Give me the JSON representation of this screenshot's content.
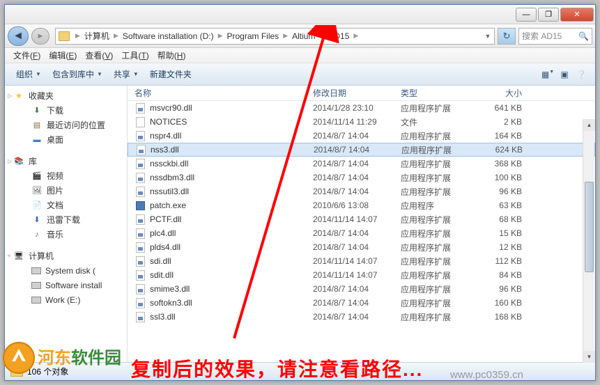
{
  "window": {
    "min": "—",
    "max": "❐",
    "close": "✕"
  },
  "nav": {
    "back": "◄",
    "fwd": "►",
    "refresh": "↻",
    "dropdown": "▼"
  },
  "breadcrumbs": [
    "计算机",
    "Software installation (D:)",
    "Program Files",
    "Altium",
    "AD15"
  ],
  "search": {
    "placeholder": "搜索 AD15",
    "icon": "🔍"
  },
  "menubar": [
    {
      "label": "文件",
      "key": "F"
    },
    {
      "label": "编辑",
      "key": "E"
    },
    {
      "label": "查看",
      "key": "V"
    },
    {
      "label": "工具",
      "key": "T"
    },
    {
      "label": "帮助",
      "key": "H"
    }
  ],
  "toolbar": {
    "organize": "组织",
    "include": "包含到库中",
    "share": "共享",
    "newfolder": "新建文件夹"
  },
  "columns": {
    "name": "名称",
    "date": "修改日期",
    "type": "类型",
    "size": "大小"
  },
  "sidebar": {
    "favorites": "收藏夹",
    "downloads": "下载",
    "recent": "最近访问的位置",
    "desktop": "桌面",
    "libraries": "库",
    "videos": "视频",
    "pictures": "图片",
    "documents": "文档",
    "xunlei": "迅雷下载",
    "music": "音乐",
    "computer": "计算机",
    "sysdisk": "System disk (",
    "softinst": "Software install",
    "work": "Work (E:)"
  },
  "files": [
    {
      "icon": "dll",
      "name": "msvcr90.dll",
      "date": "2014/1/28 23:10",
      "type": "应用程序扩展",
      "size": "641 KB"
    },
    {
      "icon": "txt",
      "name": "NOTICES",
      "date": "2014/11/14 11:29",
      "type": "文件",
      "size": "2 KB"
    },
    {
      "icon": "dll",
      "name": "nspr4.dll",
      "date": "2014/8/7 14:04",
      "type": "应用程序扩展",
      "size": "164 KB"
    },
    {
      "icon": "dll",
      "name": "nss3.dll",
      "date": "2014/8/7 14:04",
      "type": "应用程序扩展",
      "size": "624 KB",
      "selected": true
    },
    {
      "icon": "dll",
      "name": "nssckbi.dll",
      "date": "2014/8/7 14:04",
      "type": "应用程序扩展",
      "size": "368 KB"
    },
    {
      "icon": "dll",
      "name": "nssdbm3.dll",
      "date": "2014/8/7 14:04",
      "type": "应用程序扩展",
      "size": "100 KB"
    },
    {
      "icon": "dll",
      "name": "nssutil3.dll",
      "date": "2014/8/7 14:04",
      "type": "应用程序扩展",
      "size": "96 KB"
    },
    {
      "icon": "exe",
      "name": "patch.exe",
      "date": "2010/6/6 13:08",
      "type": "应用程序",
      "size": "63 KB"
    },
    {
      "icon": "dll",
      "name": "PCTF.dll",
      "date": "2014/11/14 14:07",
      "type": "应用程序扩展",
      "size": "68 KB"
    },
    {
      "icon": "dll",
      "name": "plc4.dll",
      "date": "2014/8/7 14:04",
      "type": "应用程序扩展",
      "size": "15 KB"
    },
    {
      "icon": "dll",
      "name": "plds4.dll",
      "date": "2014/8/7 14:04",
      "type": "应用程序扩展",
      "size": "12 KB"
    },
    {
      "icon": "dll",
      "name": "sdi.dll",
      "date": "2014/11/14 14:07",
      "type": "应用程序扩展",
      "size": "112 KB"
    },
    {
      "icon": "dll",
      "name": "sdit.dll",
      "date": "2014/11/14 14:07",
      "type": "应用程序扩展",
      "size": "84 KB"
    },
    {
      "icon": "dll",
      "name": "smime3.dll",
      "date": "2014/8/7 14:04",
      "type": "应用程序扩展",
      "size": "96 KB"
    },
    {
      "icon": "dll",
      "name": "softokn3.dll",
      "date": "2014/8/7 14:04",
      "type": "应用程序扩展",
      "size": "160 KB"
    },
    {
      "icon": "dll",
      "name": "ssl3.dll",
      "date": "2014/8/7 14:04",
      "type": "应用程序扩展",
      "size": "168 KB"
    }
  ],
  "status": {
    "count": "106 个对象"
  },
  "overlay": {
    "text": "复制后的效果，请注意看路径...",
    "brand": "河东软件园",
    "url": "www.pc0359.cn"
  }
}
